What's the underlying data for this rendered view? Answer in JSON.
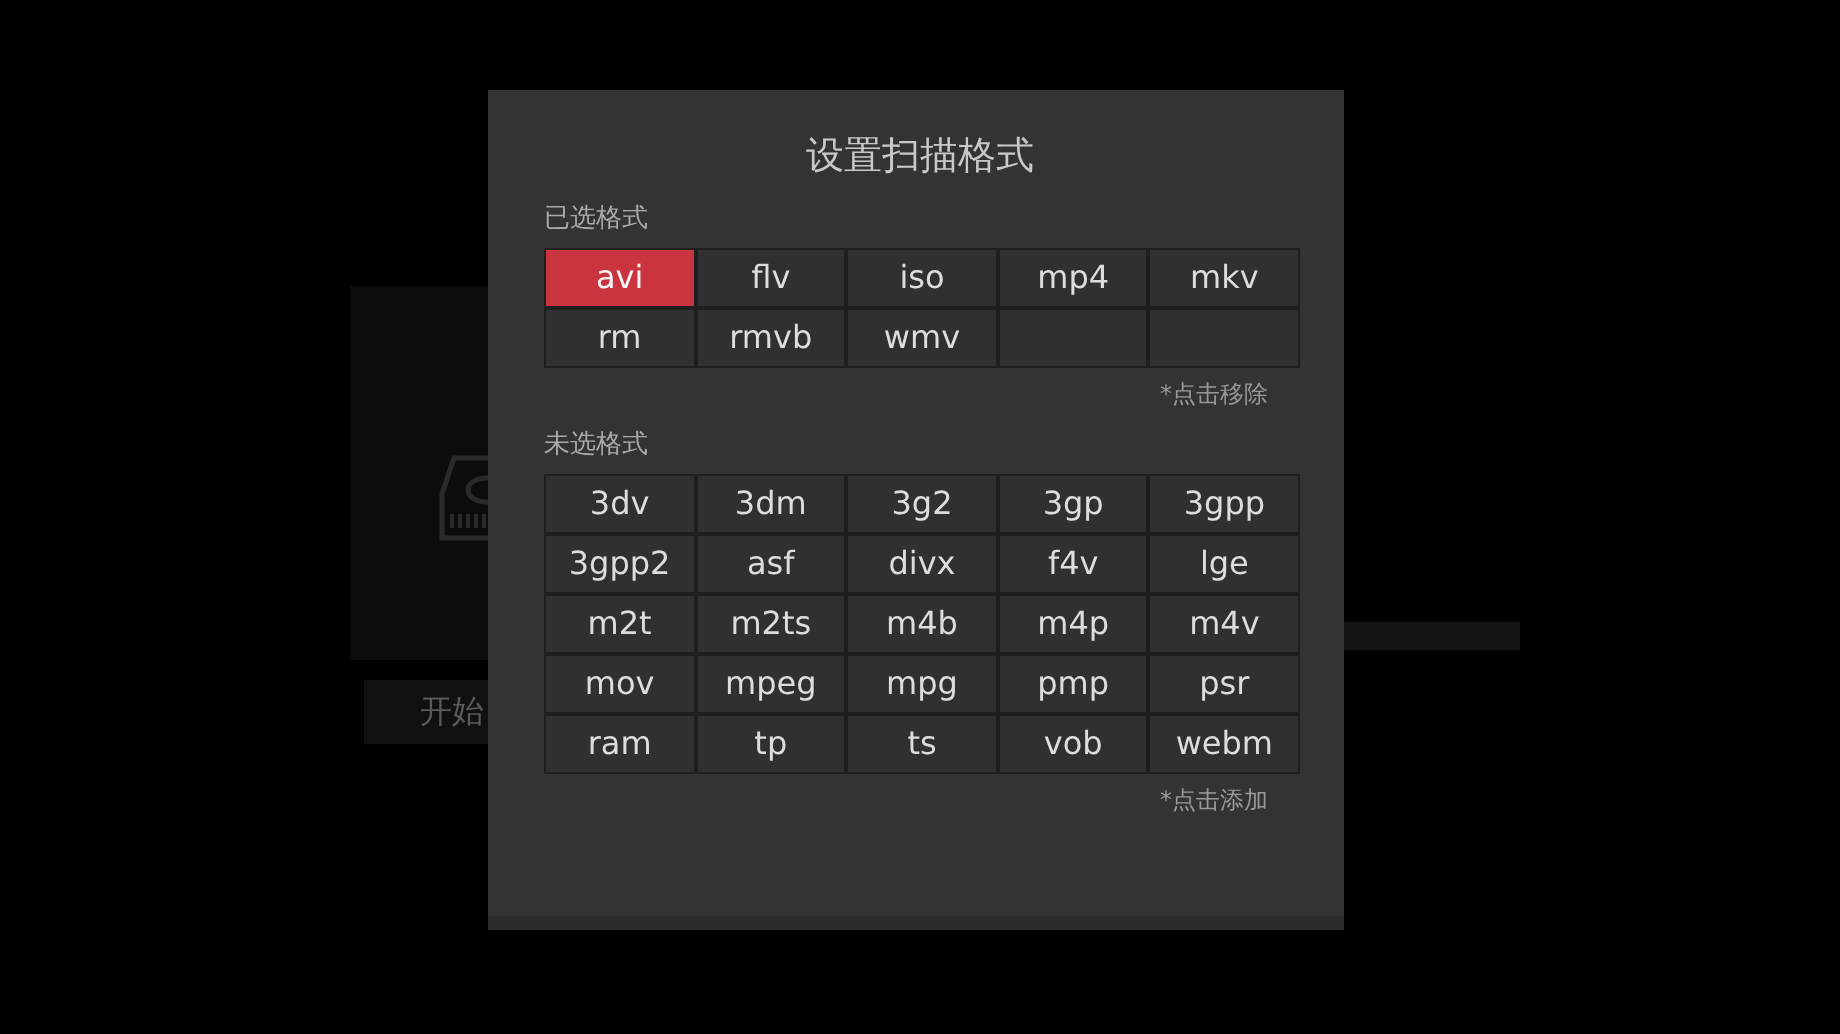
{
  "background": {
    "button_label": "开始"
  },
  "dialog": {
    "title": "设置扫描格式",
    "selected_section": {
      "label": "已选格式",
      "hint": "*点击移除",
      "formats": [
        {
          "label": "avi",
          "selected": true
        },
        {
          "label": "flv",
          "selected": false
        },
        {
          "label": "iso",
          "selected": false
        },
        {
          "label": "mp4",
          "selected": false
        },
        {
          "label": "mkv",
          "selected": false
        },
        {
          "label": "rm",
          "selected": false
        },
        {
          "label": "rmvb",
          "selected": false
        },
        {
          "label": "wmv",
          "selected": false
        }
      ]
    },
    "available_section": {
      "label": "未选格式",
      "hint": "*点击添加",
      "formats": [
        "3dv",
        "3dm",
        "3g2",
        "3gp",
        "3gpp",
        "3gpp2",
        "asf",
        "divx",
        "f4v",
        "lge",
        "m2t",
        "m2ts",
        "m4b",
        "m4p",
        "m4v",
        "mov",
        "mpeg",
        "mpg",
        "pmp",
        "psr",
        "ram",
        "tp",
        "ts",
        "vob",
        "webm"
      ]
    }
  }
}
